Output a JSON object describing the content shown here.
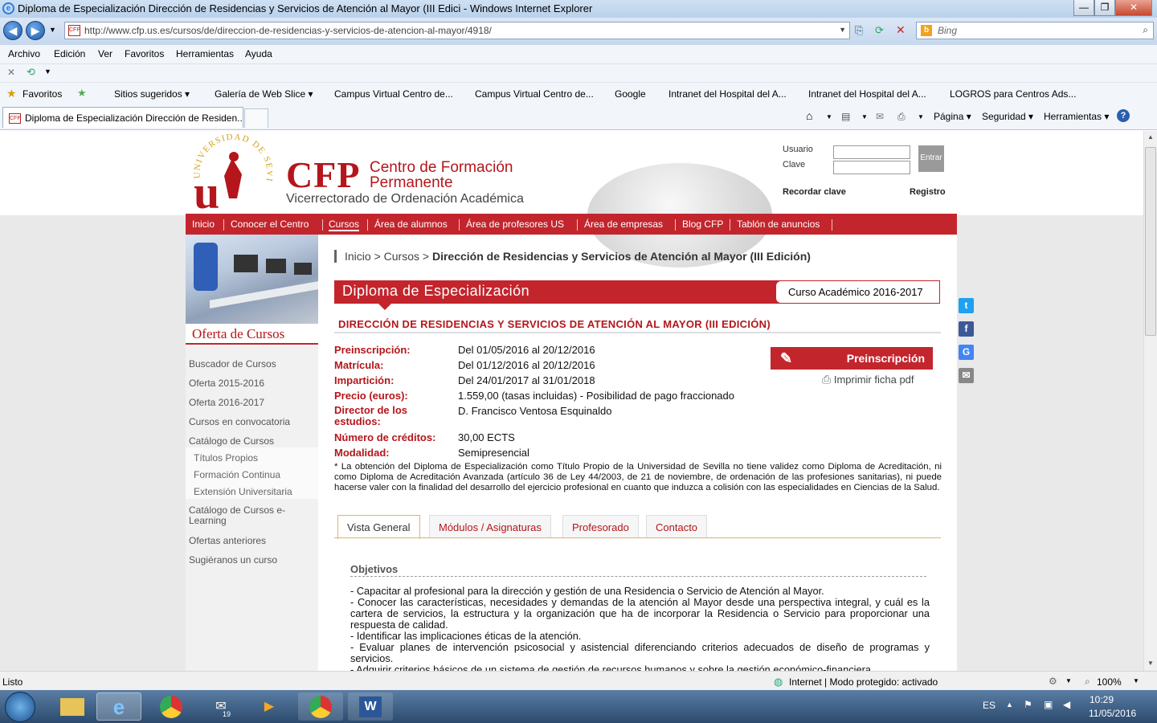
{
  "window": {
    "title": "Diploma de Especialización Dirección de Residencias y Servicios de Atención al Mayor (III Edici - Windows Internet Explorer",
    "minimize": "—",
    "restore": "❐",
    "close": "✕"
  },
  "address": {
    "url": "http://www.cfp.us.es/cursos/de/direccion-de-residencias-y-servicios-de-atencion-al-mayor/4918/",
    "search_placeholder": "Bing",
    "favicon": "CFP"
  },
  "menu": [
    "Archivo",
    "Edición",
    "Ver",
    "Favoritos",
    "Herramientas",
    "Ayuda"
  ],
  "favorites_bar": {
    "favorites": "Favoritos",
    "items": [
      "Sitios sugeridos ▾",
      "Galería de Web Slice ▾",
      "Campus Virtual Centro de...",
      "Campus Virtual Centro de...",
      "Google",
      "Intranet del Hospital del A...",
      "Intranet del Hospital del A...",
      "LOGROS para Centros Ads..."
    ]
  },
  "tab": {
    "label": "Diploma de Especialización Dirección de Residen...",
    "tools": [
      "Página ▾",
      "Seguridad ▾",
      "Herramientas ▾"
    ]
  },
  "header": {
    "seal_text": "UNIVERSIDAD DE SEVILLA",
    "cfp": "CFP",
    "centro": "Centro de Formación Permanente",
    "vicerrectorado": "Vicerrectorado de Ordenación Académica",
    "usuario_label": "Usuario",
    "clave_label": "Clave",
    "entrar": "Entrar",
    "recordar": "Recordar clave",
    "registro": "Registro"
  },
  "nav": [
    "Inicio",
    "Conocer el Centro",
    "Cursos",
    "Área de alumnos",
    "Área de profesores US",
    "Área de empresas",
    "Blog CFP",
    "Tablón de anuncios"
  ],
  "sidebar": {
    "heading": "Oferta de Cursos",
    "items": [
      "Buscador de Cursos",
      "Oferta 2015-2016",
      "Oferta 2016-2017",
      "Cursos en convocatoria",
      "Catálogo de Cursos"
    ],
    "subitems": [
      "Títulos Propios",
      "Formación Continua",
      "Extensión Universitaria"
    ],
    "items2": [
      "Catálogo de Cursos e-Learning",
      "Ofertas anteriores",
      "Sugiéranos un curso"
    ]
  },
  "breadcrumb": {
    "inicio": "Inicio",
    "sep": ">",
    "cursos": "Cursos",
    "current": "Dirección de Residencias y Servicios de Atención al Mayor (III Edición)"
  },
  "course": {
    "type": "Diploma de Especialización",
    "year": "Curso Académico 2016-2017",
    "title": "DIRECCIÓN DE RESIDENCIAS Y SERVICIOS DE ATENCIÓN AL MAYOR (III EDICIÓN)",
    "fields": [
      {
        "key": "Preinscripción:",
        "value": "Del 01/05/2016 al 20/12/2016"
      },
      {
        "key": "Matrícula:",
        "value": "Del 01/12/2016 al 20/12/2016"
      },
      {
        "key": "Impartición:",
        "value": "Del 24/01/2017 al 31/01/2018"
      },
      {
        "key": "Precio (euros):",
        "value": "1.559,00 (tasas incluidas) - Posibilidad de pago fraccionado"
      },
      {
        "key": "Director de los estudios:",
        "value": "D. Francisco Ventosa Esquinaldo"
      },
      {
        "key": "Número de créditos:",
        "value": "30,00 ECTS"
      },
      {
        "key": "Modalidad:",
        "value": "Semipresencial"
      }
    ],
    "preinscripcion_button": "Preinscripción",
    "print": "Imprimir ficha pdf",
    "note": "* La obtención del Diploma de Especialización como Título Propio de la Universidad de Sevilla no tiene validez como Diploma de Acreditación, ni como Diploma de Acreditación Avanzada (artículo 36 de Ley 44/2003, de 21 de noviembre, de ordenación de las profesiones sanitarias), ni puede hacerse valer con la finalidad del desarrollo del ejercicio profesional en cuanto que induzca a colisión con las especialidades en Ciencias de la Salud.",
    "tabs": [
      "Vista General",
      "Módulos / Asignaturas",
      "Profesorado",
      "Contacto"
    ],
    "objetivos_title": "Objetivos",
    "objetivos": [
      "- Capacitar al profesional para la dirección y gestión de una Residencia o Servicio de Atención al Mayor.",
      "- Conocer las características, necesidades y demandas de la atención al Mayor desde una perspectiva integral, y cuál es la cartera de servicios, la estructura y la organización que ha de incorporar la Residencia o Servicio para proporcionar una respuesta de calidad.",
      "- Identificar las implicaciones éticas de la atención.",
      "- Evaluar planes de intervención psicosocial y asistencial diferenciando criterios adecuados de diseño de programas y servicios.",
      "- Adquirir criterios básicos de un sistema de gestión de recursos humanos y sobre la gestión económico-financiera"
    ]
  },
  "share": {
    "twitter": "t",
    "facebook": "f",
    "google": "G",
    "email": "✉"
  },
  "status": {
    "left": "Listo",
    "zone": "Internet | Modo protegido: activado",
    "zoom": "100%"
  },
  "taskbar": {
    "lang": "ES",
    "time": "10:29",
    "date": "11/05/2016",
    "badge": "19"
  }
}
